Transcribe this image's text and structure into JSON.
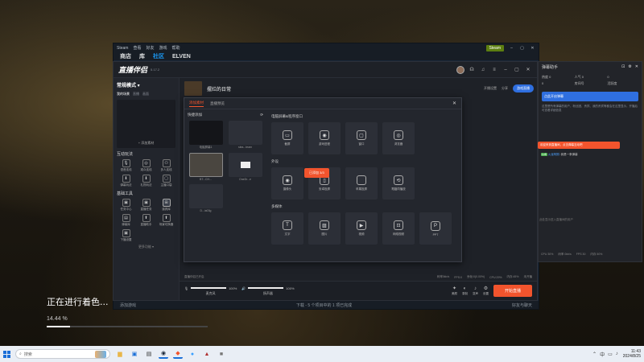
{
  "steam": {
    "title": "Steam",
    "menu": [
      "查看",
      "好友",
      "游戏",
      "帮助"
    ],
    "username": "Steam",
    "nav": [
      "商店",
      "库",
      "社区",
      "ELVEN"
    ],
    "bottom_left": "添加游戏",
    "bottom_mid": "下载 - 5 个项目中的 1 项已完成",
    "bottom_right": "好友与聊天"
  },
  "app": {
    "logo": "直播伴侣",
    "version": "5.17.2",
    "mode_label": "常规模式 ▾",
    "mode_tabs": [
      "我的场景",
      "直播",
      "画面"
    ],
    "add_scene": "+ 添加素材",
    "room_title": "摆烂的日常",
    "top_actions": [
      "开播设置",
      "分享"
    ],
    "blue_pill": "游戏直播",
    "interaction_title": "互动玩法",
    "interaction_tools": [
      {
        "label": "语音连线",
        "glyph": "🎙"
      },
      {
        "label": "观众连线",
        "glyph": "◎"
      },
      {
        "label": "多人连线",
        "glyph": "⚇"
      },
      {
        "label": "弹幕玩法",
        "glyph": "⬇"
      },
      {
        "label": "礼物玩法",
        "glyph": "⬇"
      },
      {
        "label": "主播口袋",
        "glyph": "▢"
      }
    ],
    "basic_title": "基础工具",
    "basic_tools": [
      {
        "label": "任务中心",
        "glyph": "▣"
      },
      {
        "label": "直播任务",
        "glyph": "▣"
      },
      {
        "label": "道具库",
        "glyph": "⊞"
      },
      {
        "label": "弹幕库",
        "glyph": "▤"
      },
      {
        "label": "直播助手",
        "glyph": "⬆"
      },
      {
        "label": "场景切换器",
        "glyph": "⬆"
      },
      {
        "label": "下播设置",
        "glyph": "▣"
      }
    ],
    "more_tools": "更多功能 ▾",
    "mic_label": "麦克风",
    "mic_pct": "100%",
    "mic_level": 1.0,
    "speaker_label": "扬声器",
    "speaker_pct": "100%",
    "speaker_level": 1.0,
    "bb_icons": [
      {
        "label": "美颜",
        "glyph": "✦"
      },
      {
        "label": "录制",
        "glyph": "◐"
      },
      {
        "label": "变声",
        "glyph": "♪"
      },
      {
        "label": "设置",
        "glyph": "⚙"
      }
    ],
    "live_button": "开始直播",
    "status_items": [
      "直播伴侣已开启",
      "码率0kb/s",
      "FPS:0",
      "丢帧:0(0.00%)",
      "CPU:29%",
      "内存:45%",
      "未开播"
    ]
  },
  "dialog": {
    "tabs": [
      "添加素材",
      "直播预览"
    ],
    "quick_add": "快捷添加",
    "thumbs": [
      {
        "label": "电脑屏幕1",
        "style": "dark"
      },
      {
        "label": "slea...team",
        "style": "plain"
      },
      {
        "label": "BT...CH...",
        "style": "sel"
      },
      {
        "label": "OneDr...e",
        "style": "white"
      },
      {
        "label": "D...ia03g",
        "style": "plain"
      }
    ],
    "group_screen": "电脑屏幕&程序窗口",
    "screen_sources": [
      {
        "label": "截屏",
        "glyph": "▭"
      },
      {
        "label": "游戏进程",
        "glyph": "◉"
      },
      {
        "label": "窗口",
        "glyph": "▢"
      },
      {
        "label": "浏览器",
        "glyph": "◎"
      }
    ],
    "group_device": "外设",
    "device_sources": [
      {
        "label": "摄像头",
        "glyph": "◉"
      },
      {
        "label": "安卓投屏",
        "glyph": "▯"
      },
      {
        "label": "苹果投屏",
        "glyph": ""
      },
      {
        "label": "電腦同播放",
        "glyph": "⟲"
      }
    ],
    "group_media": "多媒体",
    "media_sources": [
      {
        "label": "文字",
        "glyph": "T"
      },
      {
        "label": "图片",
        "glyph": "▨"
      },
      {
        "label": "视频",
        "glyph": "▶"
      },
      {
        "label": "网络视频",
        "glyph": "⊡"
      },
      {
        "label": "PPT",
        "glyph": "P"
      }
    ],
    "orange_badge": "已添加 3/3"
  },
  "assistant": {
    "title": "弹幕助手",
    "stats": [
      "热度 0",
      "人气 0",
      "0",
      "0",
      "房间号",
      "活跃度"
    ],
    "blue_bar": "点此开启弹幕",
    "tip": "这里是所有弹幕的用户，粉丝团、贵宾、我的贵宾等都会在这里显示，开播后可查看详细信息",
    "notice": "欢迎来到直播间，点击弹幕互动吧",
    "chat_level": "Lv6",
    "chat_user": "火龙阿刚:",
    "chat_text": "我是一条弹幕",
    "input_hint": "此处显示进入直播间的用户",
    "bottom": [
      "CPU 30%",
      "码率 0kb/s",
      "FPS 30",
      "内存 50%"
    ]
  },
  "progress": {
    "title": "正在进行着色...",
    "percent_label": "14.44 %",
    "fraction": 0.1444
  },
  "taskbar": {
    "search_placeholder": "搜索",
    "apps": [
      {
        "name": "file-explorer-icon",
        "glyph": "▆",
        "color": "#e8b64a"
      },
      {
        "name": "store-icon",
        "glyph": "▣",
        "color": "#1a6fd8"
      },
      {
        "name": "terminal-icon",
        "glyph": "▤",
        "color": "#333"
      },
      {
        "name": "steam-icon",
        "glyph": "◉",
        "color": "#1b2838"
      },
      {
        "name": "live-app-icon",
        "glyph": "◆",
        "color": "#f2542d"
      },
      {
        "name": "chat-app-icon",
        "glyph": "●",
        "color": "#3aa0ff"
      },
      {
        "name": "game-app-icon",
        "glyph": "▲",
        "color": "#b03030"
      },
      {
        "name": "other-app-icon",
        "glyph": "■",
        "color": "#777"
      }
    ],
    "time": "11:43",
    "date": "2024/8/25"
  }
}
